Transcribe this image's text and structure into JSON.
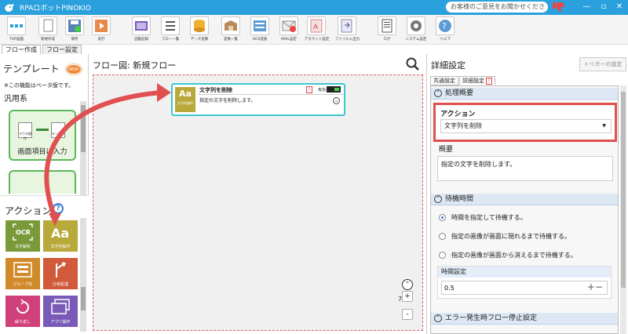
{
  "titlebar": {
    "title": "RPAロボットPINOKIO",
    "feedback": "お客様のご意見をお聞かせください",
    "minimize": "—",
    "maximize": "▫",
    "close": "✕"
  },
  "toolbar": {
    "items": [
      {
        "label": "TOP画面"
      },
      {
        "label": "新規作成"
      },
      {
        "label": "保存"
      },
      {
        "label": "実行"
      },
      {
        "label": "自動記録"
      },
      {
        "label": "フロー一覧"
      },
      {
        "label": "データ変数"
      },
      {
        "label": "変数一覧"
      },
      {
        "label": "OCR変換"
      },
      {
        "label": "MAIL設定"
      },
      {
        "label": "アカウント設定"
      },
      {
        "label": "ファイル入出力"
      },
      {
        "label": "ログ"
      },
      {
        "label": "システム設定"
      },
      {
        "label": "ヘルプ"
      }
    ]
  },
  "tabs": [
    "フロー作成",
    "フロー設定"
  ],
  "template_panel": {
    "heading": "テンプレート",
    "badge": "NEW!",
    "note": "※この機能はベータ版です。",
    "category": "汎用系",
    "card1": {
      "title": "画面項目に入力",
      "mini1": "マウス操作",
      "mini2": "キー操作"
    }
  },
  "actions_panel": {
    "heading": "アクション",
    "help": "?",
    "items": [
      {
        "label": "文字解析",
        "color": "#7a9a3a"
      },
      {
        "label": "文字列操作",
        "color": "#b9a83a"
      },
      {
        "label": "グループ化",
        "color": "#d08a2a"
      },
      {
        "label": "分岐処理",
        "color": "#d05a3a"
      },
      {
        "label": "繰り返し",
        "color": "#d0407a"
      },
      {
        "label": "アプリ操作",
        "color": "#7a5ab8"
      }
    ]
  },
  "flow": {
    "title": "フロー図:  新規フロー",
    "node": {
      "icon_text": "Aa",
      "icon_sub": "文字列操作",
      "name": "文字列を削除",
      "warning": "!",
      "valid_label": "有効",
      "description": "指定の文字を削除します。"
    },
    "zoom": "75%",
    "zoom_in": "+",
    "zoom_out": "-"
  },
  "detail": {
    "title": "詳細設定",
    "trigger_button": "トリガーの設定",
    "tabs": [
      "共通設定",
      "詳細設定"
    ],
    "section1": "処理概要",
    "action_label": "アクション",
    "action_value": "文字列を削除",
    "summary_label": "概要",
    "summary_value": "指定の文字を削除します。",
    "section2": "待機時間",
    "radios": [
      "時間を指定して待機する。",
      "指定の画像が画面に現れるまで待機する。",
      "指定の画像が画面から消えるまで待機する。"
    ],
    "time_label": "時間設定",
    "time_value": "0.5",
    "section3": "エラー発生時フロー停止設定"
  }
}
